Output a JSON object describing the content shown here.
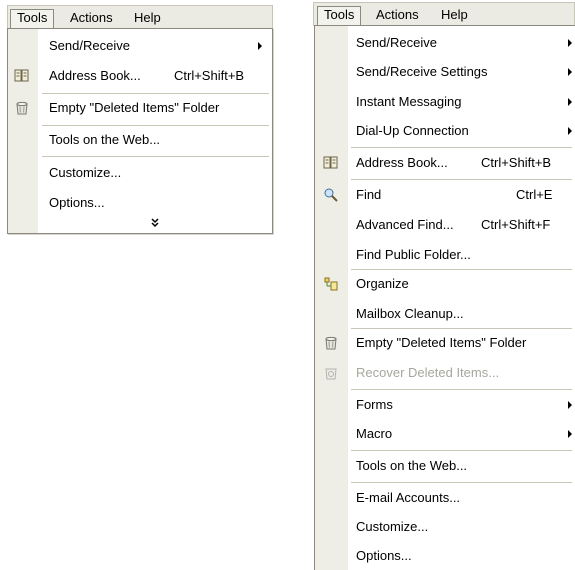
{
  "left": {
    "menubar": {
      "tools": "Tools",
      "actions": "Actions",
      "help": "Help"
    },
    "items": [
      {
        "label": "Send/Receive",
        "shortcut": "",
        "submenu": true,
        "icon": ""
      },
      {
        "label": "Address Book...",
        "shortcut": "Ctrl+Shift+B",
        "submenu": false,
        "icon": "address-book-icon"
      },
      {
        "label": "Empty \"Deleted Items\" Folder",
        "shortcut": "",
        "submenu": false,
        "icon": "recycle-bin-icon"
      },
      {
        "label": "Tools on the Web...",
        "shortcut": "",
        "submenu": false,
        "icon": ""
      },
      {
        "label": "Customize...",
        "shortcut": "",
        "submenu": false,
        "icon": ""
      },
      {
        "label": "Options...",
        "shortcut": "",
        "submenu": false,
        "icon": ""
      }
    ],
    "expand_glyph": "¥"
  },
  "right": {
    "menubar": {
      "tools": "Tools",
      "actions": "Actions",
      "help": "Help"
    },
    "items": [
      {
        "label": "Send/Receive",
        "shortcut": "",
        "submenu": true,
        "icon": ""
      },
      {
        "label": "Send/Receive Settings",
        "shortcut": "",
        "submenu": true,
        "icon": ""
      },
      {
        "label": "Instant Messaging",
        "shortcut": "",
        "submenu": true,
        "icon": ""
      },
      {
        "label": "Dial-Up Connection",
        "shortcut": "",
        "submenu": true,
        "icon": ""
      },
      {
        "label": "Address Book...",
        "shortcut": "Ctrl+Shift+B",
        "submenu": false,
        "icon": "address-book-icon"
      },
      {
        "label": "Find",
        "shortcut": "Ctrl+E",
        "submenu": false,
        "icon": "find-icon"
      },
      {
        "label": "Advanced Find...",
        "shortcut": "Ctrl+Shift+F",
        "submenu": false,
        "icon": ""
      },
      {
        "label": "Find Public Folder...",
        "shortcut": "",
        "submenu": false,
        "icon": ""
      },
      {
        "label": "Organize",
        "shortcut": "",
        "submenu": false,
        "icon": "organize-icon"
      },
      {
        "label": "Mailbox Cleanup...",
        "shortcut": "",
        "submenu": false,
        "icon": ""
      },
      {
        "label": "Empty \"Deleted Items\" Folder",
        "shortcut": "",
        "submenu": false,
        "icon": "recycle-bin-icon"
      },
      {
        "label": "Recover Deleted Items...",
        "shortcut": "",
        "submenu": false,
        "icon": "recover-deleted-icon",
        "disabled": true
      },
      {
        "label": "Forms",
        "shortcut": "",
        "submenu": true,
        "icon": ""
      },
      {
        "label": "Macro",
        "shortcut": "",
        "submenu": true,
        "icon": ""
      },
      {
        "label": "Tools on the Web...",
        "shortcut": "",
        "submenu": false,
        "icon": ""
      },
      {
        "label": "E-mail Accounts...",
        "shortcut": "",
        "submenu": false,
        "icon": ""
      },
      {
        "label": "Customize...",
        "shortcut": "",
        "submenu": false,
        "icon": ""
      },
      {
        "label": "Options...",
        "shortcut": "",
        "submenu": false,
        "icon": ""
      }
    ]
  },
  "colors": {
    "menubar_bg": "#ecebe3",
    "gutter_bg": "#efeee6",
    "menu_border": "#8c8a80",
    "separator": "#c9c6b8",
    "disabled_text": "#a7a69d"
  }
}
